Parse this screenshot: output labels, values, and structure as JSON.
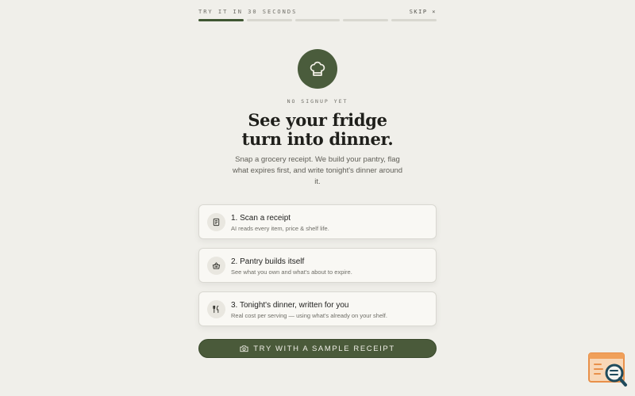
{
  "onboarding": {
    "try_label": "TRY IT IN 30 SECONDS",
    "skip_label": "SKIP ×",
    "progress": {
      "steps": 5,
      "current": 1
    },
    "eyebrow": "NO SIGNUP YET",
    "headline_line1": "See your fridge",
    "headline_line2": "turn into dinner.",
    "subtext": "Snap a grocery receipt. We build your pantry, flag what expires first, and write tonight's dinner around it.",
    "steps": [
      {
        "icon": "receipt-icon",
        "title": "1. Scan a receipt",
        "desc": "AI reads every item, price & shelf life."
      },
      {
        "icon": "basket-icon",
        "title": "2. Pantry builds itself",
        "desc": "See what you own and what's about to expire."
      },
      {
        "icon": "fork-knife-icon",
        "title": "3. Tonight's dinner, written for you",
        "desc": "Real cost per serving — using what's already on your shelf."
      }
    ],
    "cta_label": "TRY WITH A SAMPLE RECEIPT",
    "cta_icon": "camera-icon"
  },
  "colors": {
    "background": "#f0efea",
    "accent": "#4a5a3a",
    "progress_active": "#3f5632",
    "progress_inactive": "#d8d7d0",
    "corner_badge": "#f0a05a"
  },
  "corner_badge_icon": "search-doc-icon"
}
